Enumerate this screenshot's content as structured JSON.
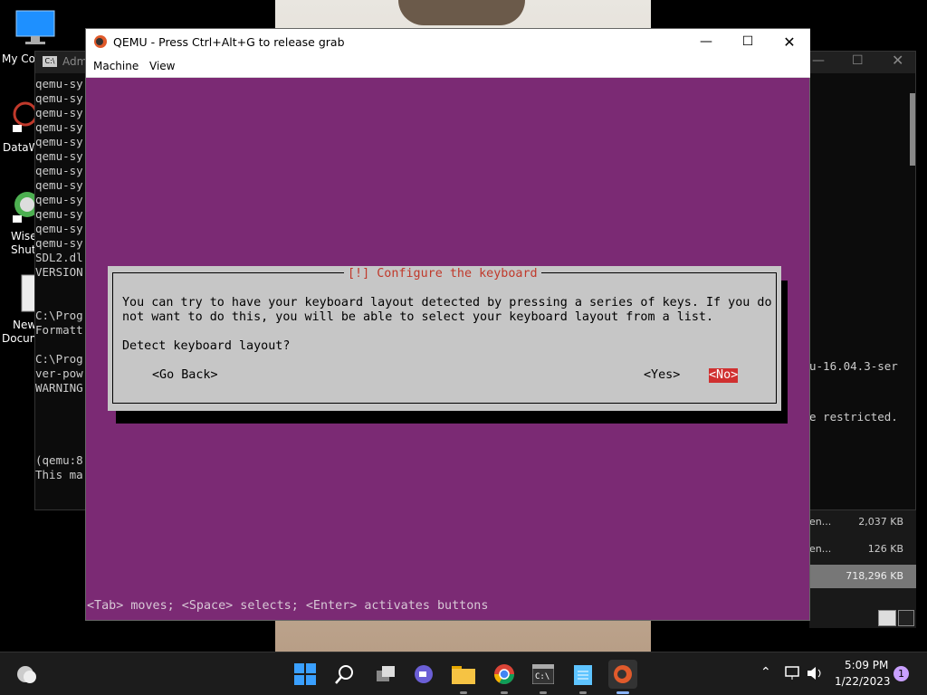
{
  "desktop": {
    "icons": [
      {
        "label": "My Co",
        "name": "my-computer"
      },
      {
        "label": "DataW",
        "name": "dataw"
      },
      {
        "label": "Wise",
        "label2": "Shutd",
        "name": "wise-shutdown"
      },
      {
        "label": "New",
        "label2": "Docum",
        "name": "new-document"
      }
    ]
  },
  "cmd_window": {
    "title": "Adm",
    "lines": [
      "qemu-sy",
      "qemu-sy",
      "qemu-sy",
      "qemu-sy",
      "qemu-sy",
      "qemu-sy",
      "qemu-sy",
      "qemu-sy",
      "qemu-sy",
      "qemu-sy",
      "qemu-sy",
      "qemu-sy",
      "SDL2.dl",
      "VERSION",
      "",
      "",
      "C:\\Prog",
      "Formatt",
      "",
      "C:\\Prog",
      "ver-pow",
      "WARNING",
      "",
      "",
      "",
      "",
      "(qemu:8",
      "This ma"
    ],
    "right_line1": "u-16.04.3-ser",
    "right_line2": "e restricted."
  },
  "explorer": {
    "rows": [
      {
        "name": "en...",
        "size": "2,037 KB"
      },
      {
        "name": "en...",
        "size": "126 KB"
      },
      {
        "name": "",
        "size": "718,296 KB"
      }
    ]
  },
  "qemu": {
    "title": "QEMU - Press Ctrl+Alt+G to release grab",
    "menu": {
      "machine": "Machine",
      "view": "View"
    },
    "dialog": {
      "title": "[!] Configure the keyboard",
      "text_line1": "You can try to have your keyboard layout detected by pressing a series of keys. If you do",
      "text_line2": "not want to do this, you will be able to select your keyboard layout from a list.",
      "question": "Detect keyboard layout?",
      "go_back": "<Go Back>",
      "yes": "<Yes>",
      "no": "<No>"
    },
    "status_line": "<Tab> moves; <Space> selects; <Enter> activates buttons",
    "colors": {
      "background": "#7b2a74",
      "dialog": "#c6c6c6",
      "highlight": "#d03030"
    }
  },
  "taskbar": {
    "apps": [
      "start-icon",
      "search-icon",
      "task-view-icon",
      "chat-icon",
      "file-explorer-icon",
      "chrome-icon",
      "terminal-icon",
      "notepad-icon",
      "qemu-icon"
    ],
    "time": "5:09 PM",
    "date": "1/22/2023",
    "notification_count": "1"
  }
}
